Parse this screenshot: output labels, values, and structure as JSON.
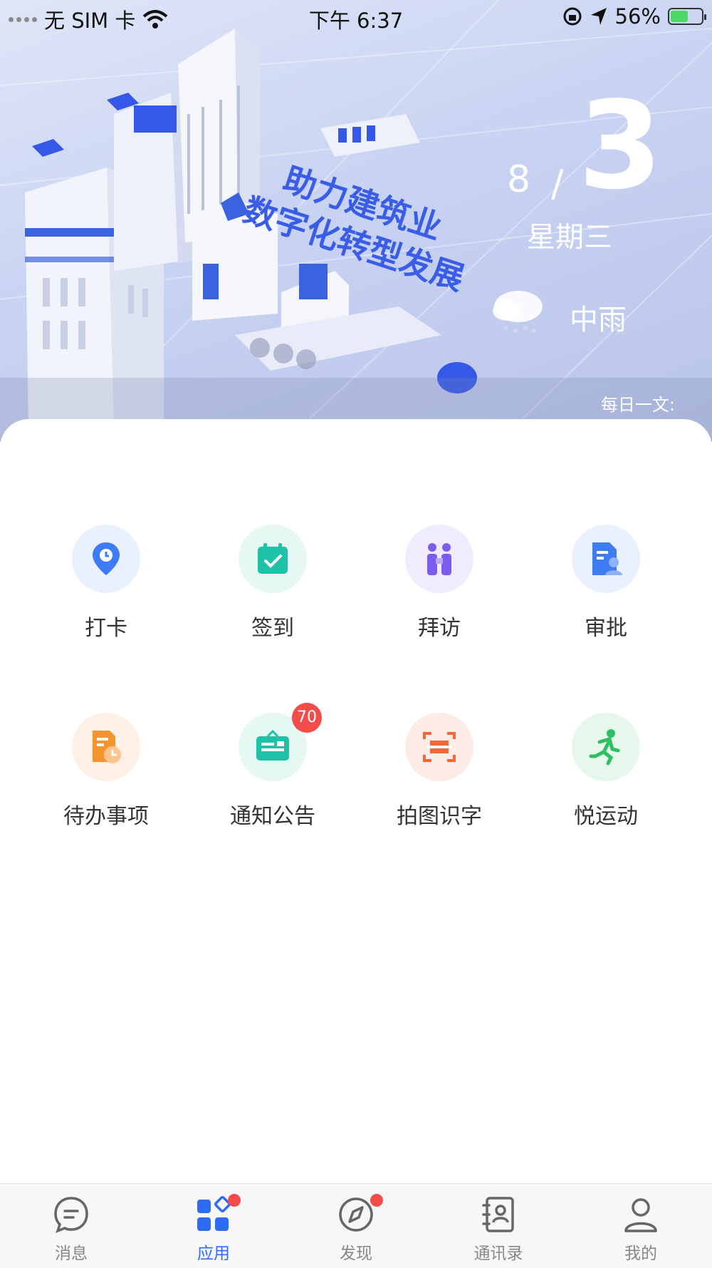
{
  "status_bar": {
    "carrier": "无 SIM 卡",
    "time": "下午 6:37",
    "battery_percent": "56%",
    "battery_level": 0.56
  },
  "banner": {
    "month": "8",
    "slash": "/",
    "day": "3",
    "weekday": "星期三",
    "weather": "中雨",
    "quote_label": "每日一文:",
    "image_text": [
      "助力建筑业",
      "数字化转型发展"
    ]
  },
  "apps": [
    {
      "label": "打卡",
      "icon": "location-pin-icon",
      "bg": "#eaf1fe",
      "color": "#3d7cf5"
    },
    {
      "label": "签到",
      "icon": "calendar-check-icon",
      "bg": "#e5f8f4",
      "color": "#1fc2a7"
    },
    {
      "label": "拜访",
      "icon": "visit-people-icon",
      "bg": "#f0ecfd",
      "color": "#7b5cf0"
    },
    {
      "label": "审批",
      "icon": "approval-doc-icon",
      "bg": "#eaf1fe",
      "color": "#3d7cf5"
    },
    {
      "label": "待办事项",
      "icon": "todo-clock-icon",
      "bg": "#fdf1e6",
      "color": "#f5932f"
    },
    {
      "label": "通知公告",
      "icon": "notice-board-icon",
      "bg": "#e5f8f4",
      "color": "#1fc2a7",
      "badge": "70"
    },
    {
      "label": "拍图识字",
      "icon": "scan-text-icon",
      "bg": "#fdece6",
      "color": "#f2683a"
    },
    {
      "label": "悦运动",
      "icon": "running-person-icon",
      "bg": "#e6f7ec",
      "color": "#2fbf63"
    }
  ],
  "tabs": [
    {
      "label": "消息",
      "icon": "message-icon",
      "active": false,
      "dot": false
    },
    {
      "label": "应用",
      "icon": "apps-grid-icon",
      "active": true,
      "dot": true
    },
    {
      "label": "发现",
      "icon": "compass-icon",
      "active": false,
      "dot": true
    },
    {
      "label": "通讯录",
      "icon": "contacts-book-icon",
      "active": false,
      "dot": false
    },
    {
      "label": "我的",
      "icon": "profile-icon",
      "active": false,
      "dot": false
    }
  ],
  "colors": {
    "accent": "#2f6cf6",
    "badge": "#f44b4b"
  }
}
